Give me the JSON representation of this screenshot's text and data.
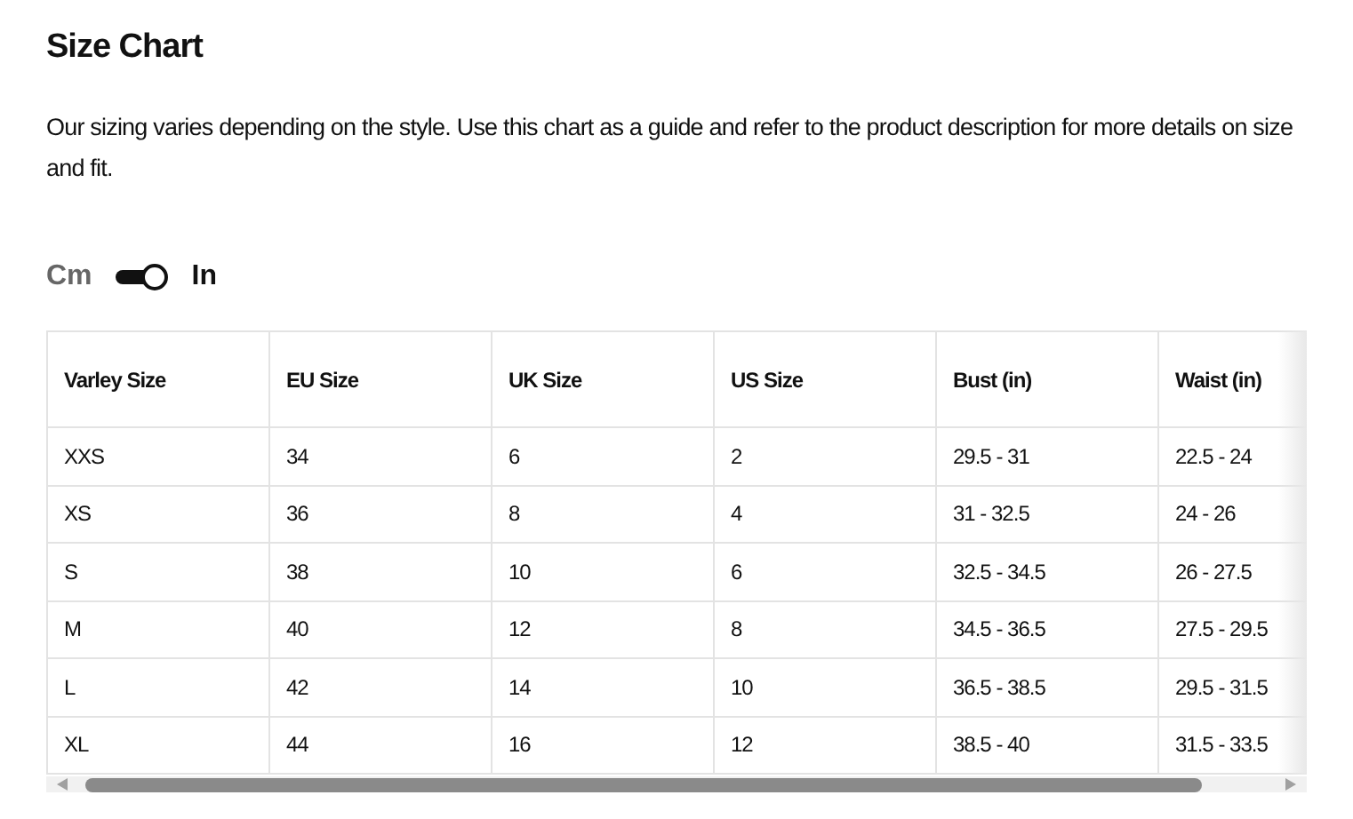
{
  "title": "Size Chart",
  "description": "Our sizing varies depending on the style. Use this chart as a guide and refer to the product description for more details on size and fit.",
  "unit_toggle": {
    "options": [
      {
        "label": "Cm",
        "selected": false
      },
      {
        "label": "In",
        "selected": true
      }
    ]
  },
  "table": {
    "columns": [
      "Varley Size",
      "EU Size",
      "UK Size",
      "US Size",
      "Bust (in)",
      "Waist (in)"
    ],
    "rows": [
      [
        "XXS",
        "34",
        "6",
        "2",
        "29.5 - 31",
        "22.5 - 24"
      ],
      [
        "XS",
        "36",
        "8",
        "4",
        "31 - 32.5",
        "24 - 26"
      ],
      [
        "S",
        "38",
        "10",
        "6",
        "32.5 - 34.5",
        "26 - 27.5"
      ],
      [
        "M",
        "40",
        "12",
        "8",
        "34.5 - 36.5",
        "27.5 - 29.5"
      ],
      [
        "L",
        "42",
        "14",
        "10",
        "36.5 - 38.5",
        "29.5 - 31.5"
      ],
      [
        "XL",
        "44",
        "16",
        "12",
        "38.5 - 40",
        "31.5 - 33.5"
      ]
    ]
  }
}
